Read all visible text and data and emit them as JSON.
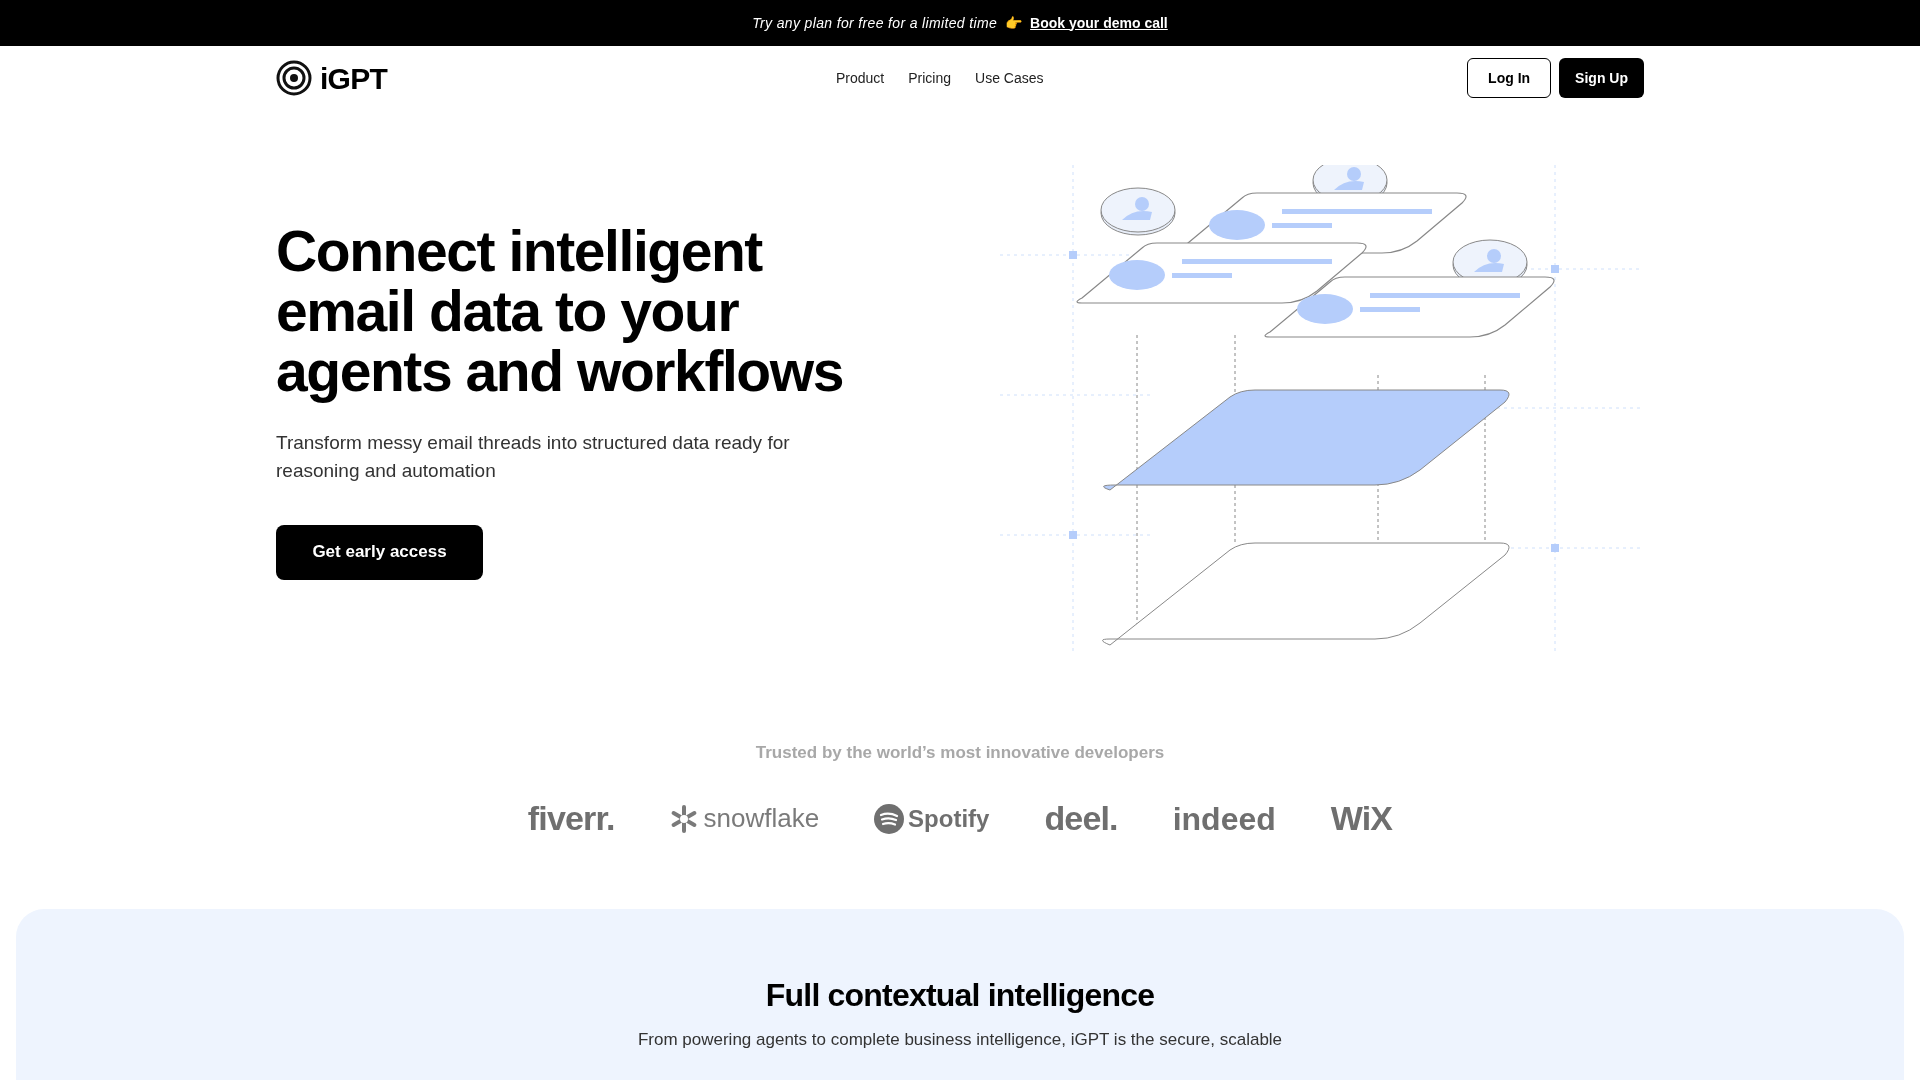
{
  "banner": {
    "text": "Try any plan for free for a limited time",
    "emoji": "👉",
    "link": "Book your demo call"
  },
  "nav": {
    "logo": "iGPT",
    "links": [
      "Product",
      "Pricing",
      "Use Cases"
    ],
    "buttons": [
      {
        "label": "Log In",
        "kind": "outline"
      },
      {
        "label": "Sign Up",
        "kind": "solid"
      }
    ]
  },
  "hero": {
    "title_lines": [
      "Connect intelligent",
      "email data to your",
      "agents and workflows"
    ],
    "subtitle": "Transform messy email threads into structured data ready for reasoning and automation",
    "cta": "Get early access"
  },
  "trusted": {
    "heading": "Trusted by the world’s most innovative developers",
    "logos": [
      {
        "name": "fiverr.",
        "kind": "bold"
      },
      {
        "name": "snowflake",
        "kind": "snowflake"
      },
      {
        "name": "Spotify",
        "kind": "spotify"
      },
      {
        "name": "deel.",
        "kind": "bold"
      },
      {
        "name": "indeed",
        "kind": "indeed"
      },
      {
        "name": "WiX",
        "kind": "bold"
      }
    ]
  },
  "features": {
    "title": "Full contextual intelligence",
    "text": "From powering agents to complete business intelligence, iGPT is the secure, scalable"
  }
}
